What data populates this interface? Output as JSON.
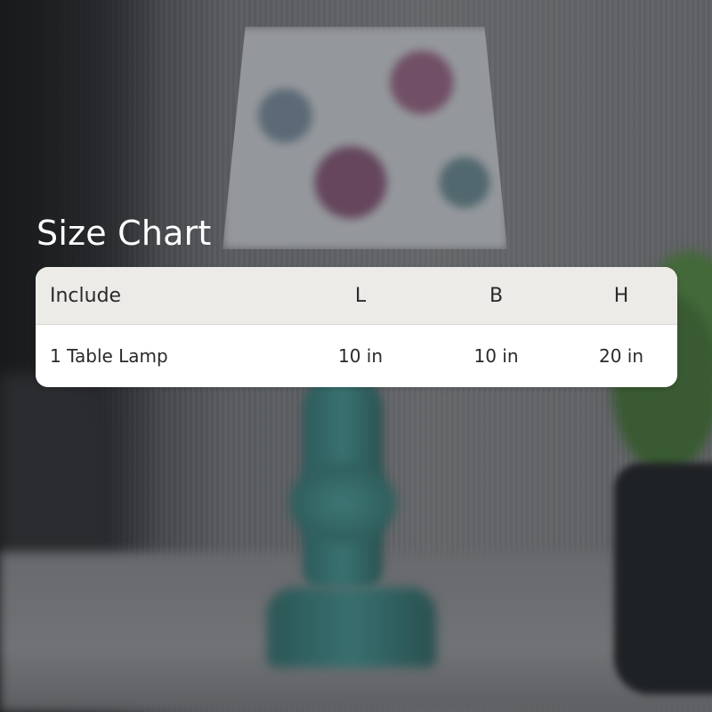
{
  "title": "Size Chart",
  "table": {
    "headers": [
      "Include",
      "L",
      "B",
      "H"
    ],
    "rows": [
      [
        "1 Table Lamp",
        "10 in",
        "10 in",
        "20 in"
      ]
    ]
  }
}
